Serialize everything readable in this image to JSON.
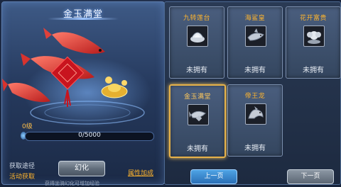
{
  "left_panel": {
    "title": "金玉满堂",
    "level": "0级",
    "exp_text": "0/5000",
    "exp_fraction": 0,
    "obtain_label": "获取途径",
    "obtain_link": "活动获取",
    "huanhua_button": "幻化",
    "attr_link": "属性加成",
    "bottom_note": "获得坐骑幻化可增加经验"
  },
  "cards": [
    {
      "name": "九转莲台",
      "status": "未拥有",
      "icon": "lotus-mount-icon",
      "selected": false
    },
    {
      "name": "海鲨皇",
      "status": "未拥有",
      "icon": "shark-mount-icon",
      "selected": false
    },
    {
      "name": "花开富贵",
      "status": "未拥有",
      "icon": "flower-mount-icon",
      "selected": false
    },
    {
      "name": "金玉满堂",
      "status": "未拥有",
      "icon": "koi-mount-icon",
      "selected": true
    },
    {
      "name": "帝王龙",
      "status": "未拥有",
      "icon": "dragon-mount-icon",
      "selected": false
    }
  ],
  "pager": {
    "prev_label": "上一页",
    "next_label": "下一页"
  }
}
